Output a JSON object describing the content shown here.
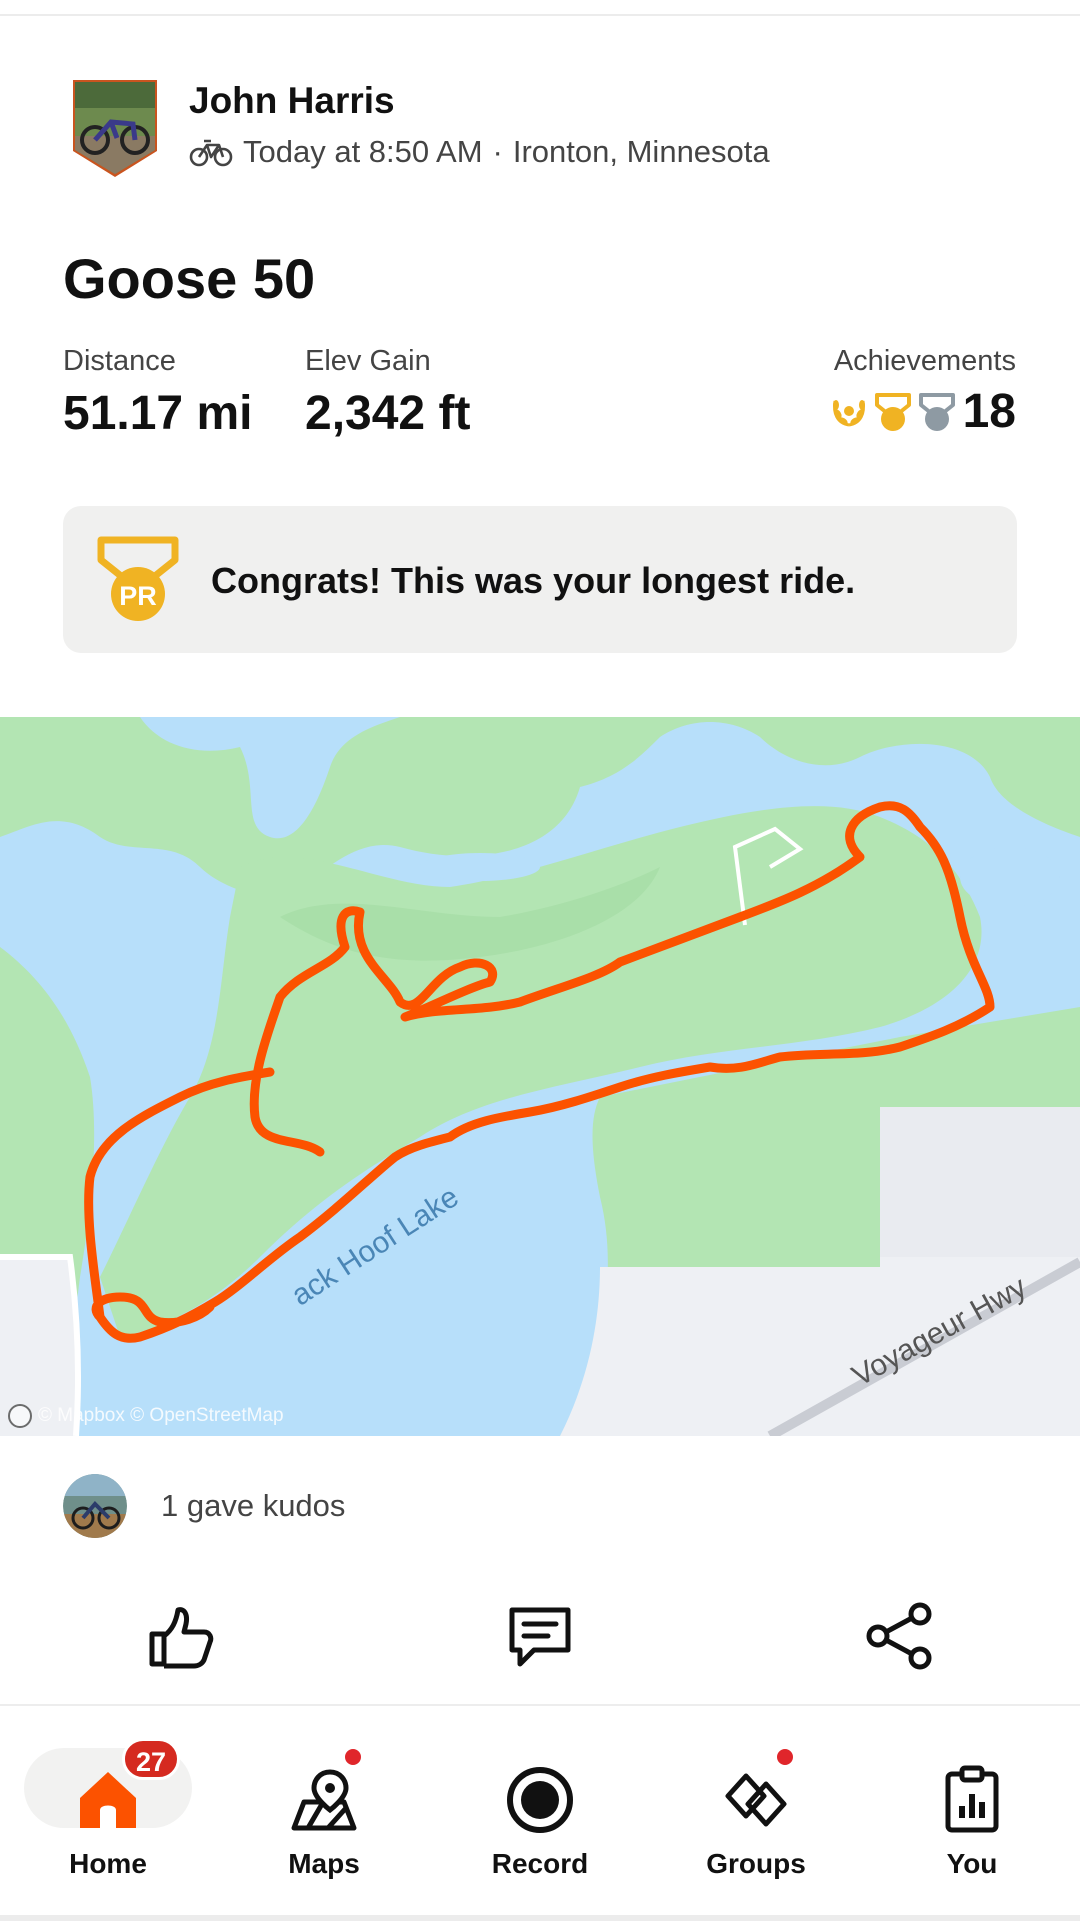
{
  "activity": {
    "athlete_name": "John Harris",
    "activity_type_icon": "bike-icon",
    "timestamp": "Today at 8:50 AM",
    "separator": "·",
    "location": "Ironton, Minnesota",
    "title": "Goose 50"
  },
  "stats": {
    "distance_label": "Distance",
    "distance_value": "51.17 mi",
    "elev_label": "Elev Gain",
    "elev_value": "2,342 ft",
    "achievements_label": "Achievements",
    "achievements_count": "18",
    "achievement_icons": [
      "laurel-icon",
      "gold-medal-icon",
      "silver-medal-icon"
    ]
  },
  "congrats": {
    "badge_text": "PR",
    "message": "Congrats! This was your longest ride."
  },
  "map": {
    "lake_label": "ack Hoof Lake",
    "road_label": "Voyageur Hwy",
    "attribution": "© Mapbox © OpenStreetMap",
    "colors": {
      "water": "#b7dffa",
      "land": "#b3e5b3",
      "route": "#fc5200",
      "developed": "#eef0f4"
    }
  },
  "kudos": {
    "text": "1 gave kudos"
  },
  "actions": {
    "kudos_icon": "thumbs-up-icon",
    "comment_icon": "comment-icon",
    "share_icon": "share-icon"
  },
  "tabs": [
    {
      "label": "Home",
      "icon": "home-icon",
      "badge": "27"
    },
    {
      "label": "Maps",
      "icon": "maps-icon"
    },
    {
      "label": "Record",
      "icon": "record-icon"
    },
    {
      "label": "Groups",
      "icon": "groups-icon"
    },
    {
      "label": "You",
      "icon": "you-icon"
    }
  ],
  "colors": {
    "brand": "#fc5200",
    "gold": "#f0b323",
    "silver": "#8e9aa3",
    "badge_red": "#d52a20"
  }
}
